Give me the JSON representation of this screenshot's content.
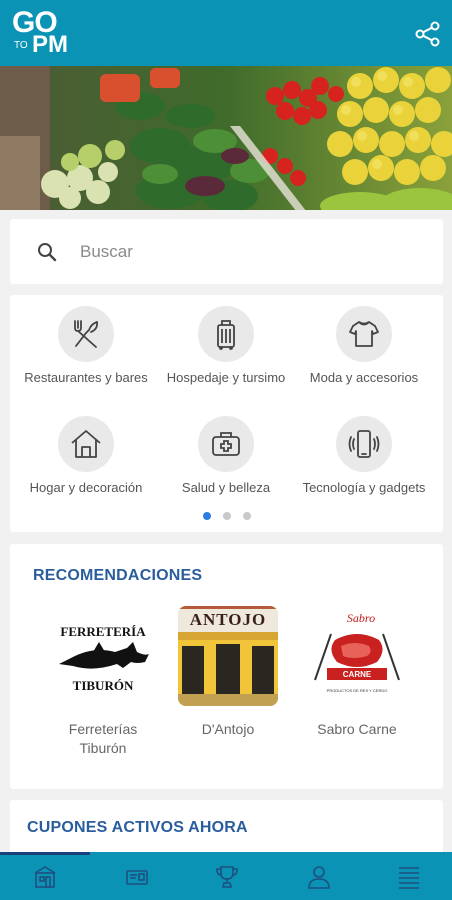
{
  "header": {
    "logo": {
      "line1": "GO",
      "line2_small": "TO",
      "line2_large": "PM"
    },
    "share_icon": "share-icon"
  },
  "search": {
    "placeholder": "Buscar",
    "icon": "search-icon"
  },
  "categories": {
    "items": [
      {
        "label": "Restaurantes y bares",
        "icon": "fork-knife-icon"
      },
      {
        "label": "Hospedaje y tursimo",
        "icon": "suitcase-icon"
      },
      {
        "label": "Moda y accesorios",
        "icon": "shirt-icon"
      },
      {
        "label": "Hogar y decoración",
        "icon": "house-icon"
      },
      {
        "label": "Salud y belleza",
        "icon": "first-aid-kit-icon"
      },
      {
        "label": "Tecnología y gadgets",
        "icon": "smartphone-icon"
      }
    ],
    "pager": {
      "pages": 3,
      "active": 1
    }
  },
  "recommendations": {
    "title": "RECOMENDACIONES",
    "items": [
      {
        "name": "Ferreterías Tiburón",
        "logo_text_top": "FERRETERÍA",
        "logo_text_bottom": "TIBURÓN"
      },
      {
        "name": "D'Antojo",
        "sign_text": "ANTOJO"
      },
      {
        "name": "Sabro Carne",
        "logo_text_top": "Sabro",
        "logo_text_bottom": "CARNE",
        "logo_tagline": "PRODUCTOS DE RES Y CERDO"
      }
    ]
  },
  "coupons": {
    "title": "CUPONES ACTIVOS AHORA"
  },
  "bottom_nav": {
    "items": [
      {
        "icon": "store-icon",
        "active": true
      },
      {
        "icon": "coupon-icon",
        "active": false
      },
      {
        "icon": "trophy-icon",
        "active": false
      },
      {
        "icon": "user-icon",
        "active": false
      },
      {
        "icon": "menu-icon",
        "active": false
      }
    ]
  },
  "colors": {
    "primary": "#0a93b4",
    "section_title": "#2a5d9d",
    "active_dot": "#2b7de1",
    "nav_indicator": "#1b3f7a"
  }
}
